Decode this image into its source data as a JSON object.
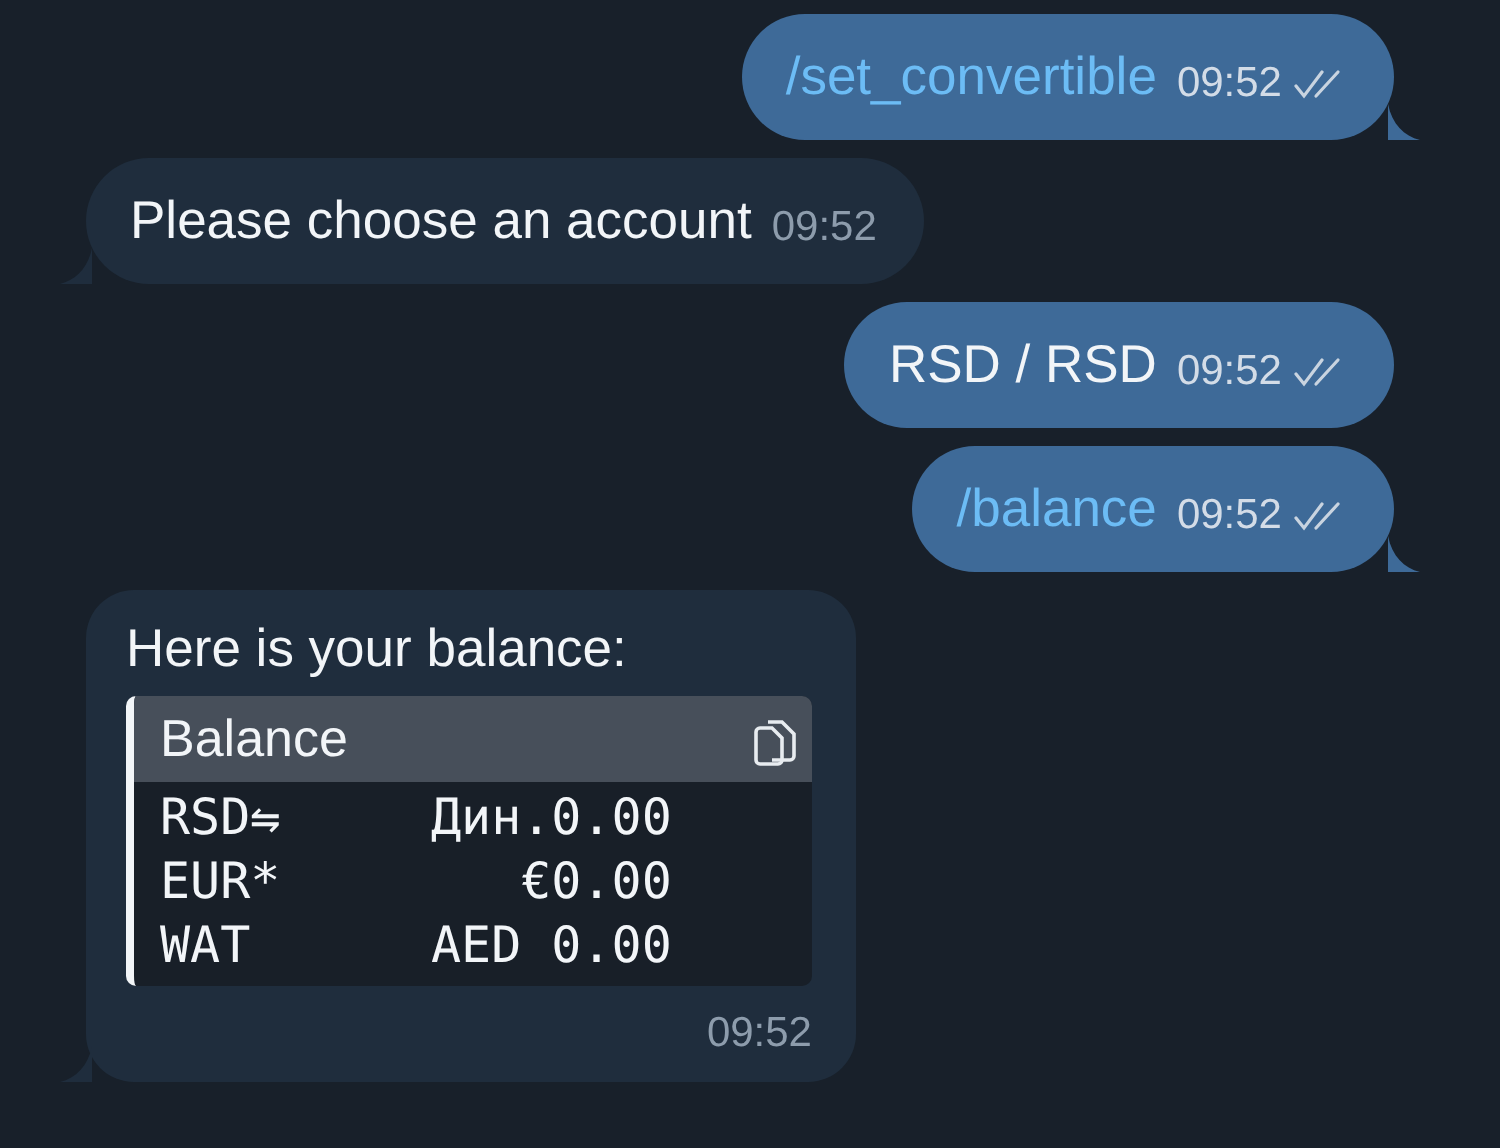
{
  "messages": [
    {
      "kind": "outgoing",
      "text": "/set_convertible",
      "is_command": true,
      "time": "09:52",
      "read": true,
      "tail": true
    },
    {
      "kind": "incoming",
      "text": "Please choose an account",
      "is_command": false,
      "time": "09:52",
      "tail": true
    },
    {
      "kind": "outgoing",
      "text": "RSD / RSD",
      "is_command": false,
      "time": "09:52",
      "read": true,
      "tail": false
    },
    {
      "kind": "outgoing",
      "text": "/balance",
      "is_command": true,
      "time": "09:52",
      "read": true,
      "tail": true
    },
    {
      "kind": "incoming",
      "text": "Here is your balance:",
      "is_command": false,
      "time": "09:52",
      "tail": true,
      "code_block": {
        "title": "Balance",
        "lines": [
          "RSD⇋     Дин.0.00",
          "EUR*        €0.00",
          "WAT      AED 0.00"
        ]
      }
    }
  ]
}
